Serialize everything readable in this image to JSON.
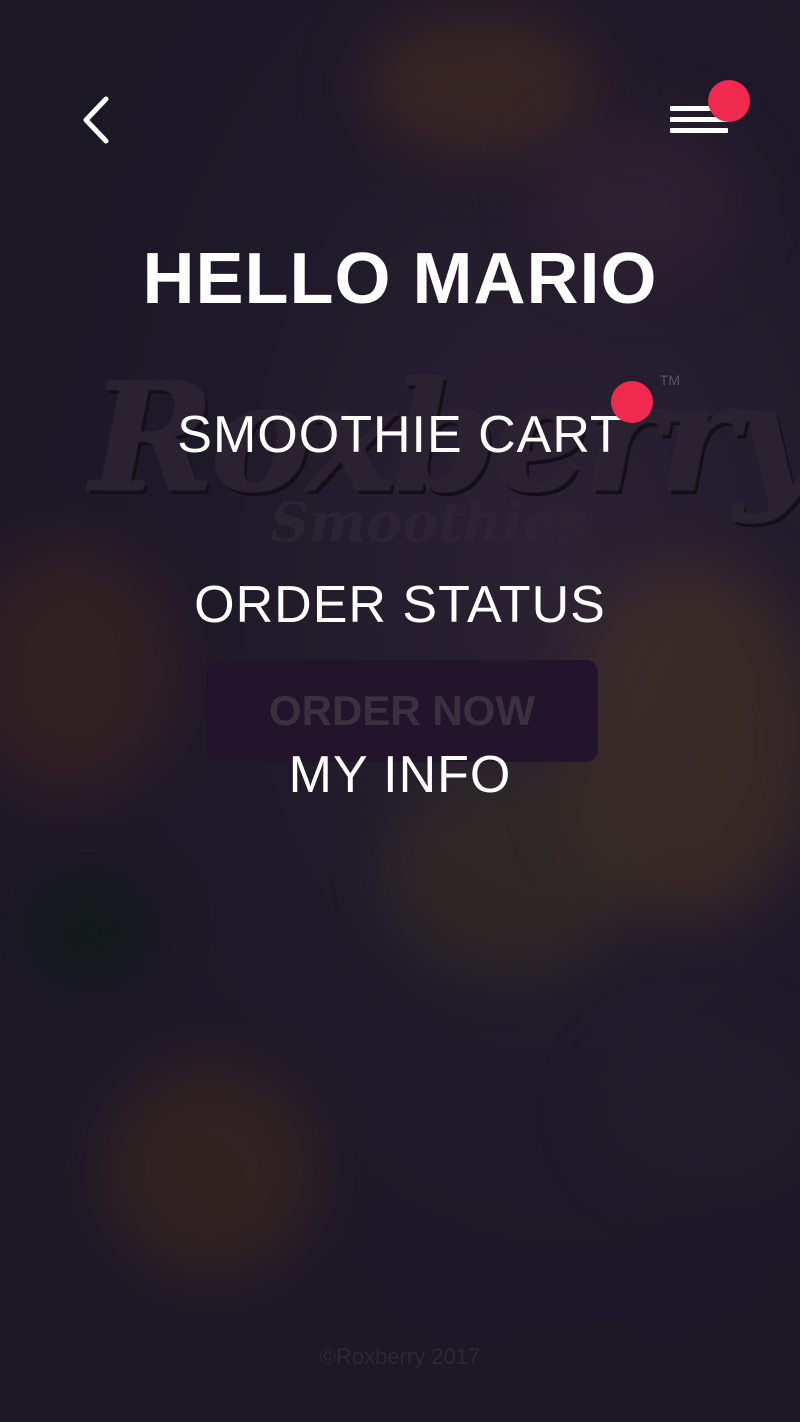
{
  "colors": {
    "background": "#1b1724",
    "accent": "#f0294e",
    "text": "#ffffff"
  },
  "header": {
    "back_icon": "chevron-left-icon",
    "menu_icon": "hamburger-menu-icon",
    "menu_has_notification": true
  },
  "greeting": "HELLO MARIO",
  "menu": {
    "items": [
      {
        "label": "SMOOTHIE CART",
        "has_notification": true
      },
      {
        "label": "ORDER STATUS",
        "has_notification": false
      },
      {
        "label": "MY INFO",
        "has_notification": false
      }
    ]
  },
  "background": {
    "logo_script": "Roxberry",
    "logo_sub": "Smoothies",
    "logo_tm": "TM",
    "order_button_label": "ORDER NOW"
  },
  "footer": {
    "copyright": "©Roxberry 2017"
  }
}
